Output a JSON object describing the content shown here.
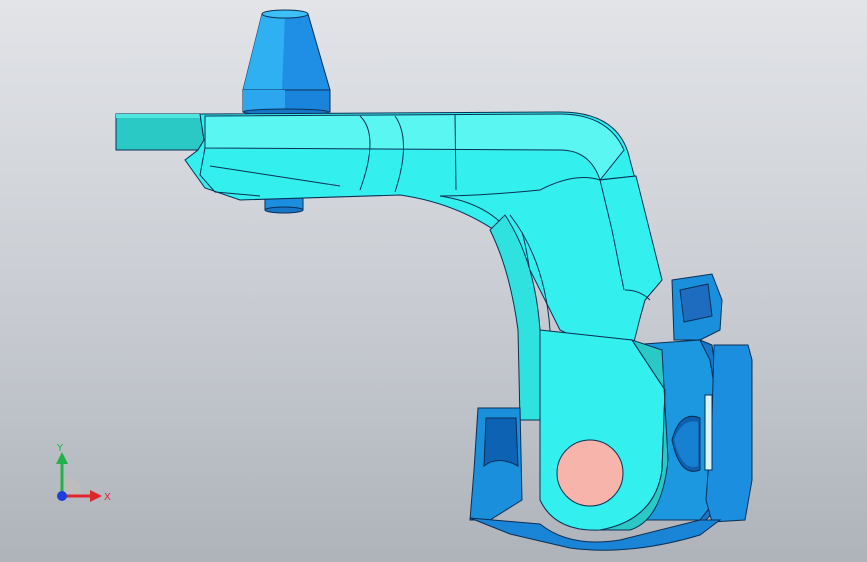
{
  "viewport": {
    "background_top": "#e2e4e8",
    "background_bottom": "#aeb3ba"
  },
  "model": {
    "primary_color": "#33f0ee",
    "secondary_color": "#1a9fe0",
    "tertiary_color": "#2ac9c6",
    "pin_face_color": "#f7b4aa",
    "edge_color": "#0a2f55"
  },
  "triad": {
    "y_label": "Y",
    "x_label": "X",
    "y_color": "#22b24c",
    "x_color": "#e0262a",
    "z_color": "#1f3fd8"
  }
}
